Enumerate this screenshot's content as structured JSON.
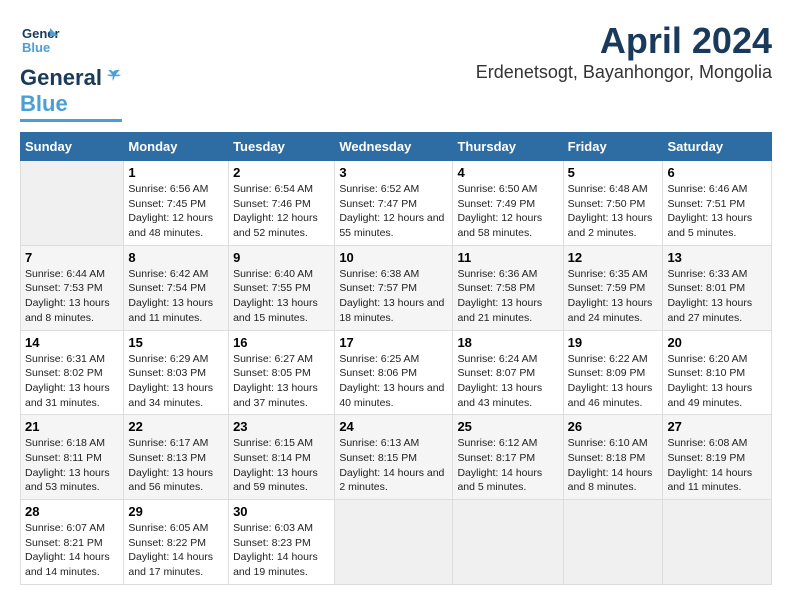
{
  "logo": {
    "line1": "General",
    "line2": "Blue"
  },
  "title": "April 2024",
  "subtitle": "Erdenetsogt, Bayanhongor, Mongolia",
  "days_of_week": [
    "Sunday",
    "Monday",
    "Tuesday",
    "Wednesday",
    "Thursday",
    "Friday",
    "Saturday"
  ],
  "weeks": [
    [
      {
        "day": "",
        "sunrise": "",
        "sunset": "",
        "daylight": ""
      },
      {
        "day": "1",
        "sunrise": "Sunrise: 6:56 AM",
        "sunset": "Sunset: 7:45 PM",
        "daylight": "Daylight: 12 hours and 48 minutes."
      },
      {
        "day": "2",
        "sunrise": "Sunrise: 6:54 AM",
        "sunset": "Sunset: 7:46 PM",
        "daylight": "Daylight: 12 hours and 52 minutes."
      },
      {
        "day": "3",
        "sunrise": "Sunrise: 6:52 AM",
        "sunset": "Sunset: 7:47 PM",
        "daylight": "Daylight: 12 hours and 55 minutes."
      },
      {
        "day": "4",
        "sunrise": "Sunrise: 6:50 AM",
        "sunset": "Sunset: 7:49 PM",
        "daylight": "Daylight: 12 hours and 58 minutes."
      },
      {
        "day": "5",
        "sunrise": "Sunrise: 6:48 AM",
        "sunset": "Sunset: 7:50 PM",
        "daylight": "Daylight: 13 hours and 2 minutes."
      },
      {
        "day": "6",
        "sunrise": "Sunrise: 6:46 AM",
        "sunset": "Sunset: 7:51 PM",
        "daylight": "Daylight: 13 hours and 5 minutes."
      }
    ],
    [
      {
        "day": "7",
        "sunrise": "Sunrise: 6:44 AM",
        "sunset": "Sunset: 7:53 PM",
        "daylight": "Daylight: 13 hours and 8 minutes."
      },
      {
        "day": "8",
        "sunrise": "Sunrise: 6:42 AM",
        "sunset": "Sunset: 7:54 PM",
        "daylight": "Daylight: 13 hours and 11 minutes."
      },
      {
        "day": "9",
        "sunrise": "Sunrise: 6:40 AM",
        "sunset": "Sunset: 7:55 PM",
        "daylight": "Daylight: 13 hours and 15 minutes."
      },
      {
        "day": "10",
        "sunrise": "Sunrise: 6:38 AM",
        "sunset": "Sunset: 7:57 PM",
        "daylight": "Daylight: 13 hours and 18 minutes."
      },
      {
        "day": "11",
        "sunrise": "Sunrise: 6:36 AM",
        "sunset": "Sunset: 7:58 PM",
        "daylight": "Daylight: 13 hours and 21 minutes."
      },
      {
        "day": "12",
        "sunrise": "Sunrise: 6:35 AM",
        "sunset": "Sunset: 7:59 PM",
        "daylight": "Daylight: 13 hours and 24 minutes."
      },
      {
        "day": "13",
        "sunrise": "Sunrise: 6:33 AM",
        "sunset": "Sunset: 8:01 PM",
        "daylight": "Daylight: 13 hours and 27 minutes."
      }
    ],
    [
      {
        "day": "14",
        "sunrise": "Sunrise: 6:31 AM",
        "sunset": "Sunset: 8:02 PM",
        "daylight": "Daylight: 13 hours and 31 minutes."
      },
      {
        "day": "15",
        "sunrise": "Sunrise: 6:29 AM",
        "sunset": "Sunset: 8:03 PM",
        "daylight": "Daylight: 13 hours and 34 minutes."
      },
      {
        "day": "16",
        "sunrise": "Sunrise: 6:27 AM",
        "sunset": "Sunset: 8:05 PM",
        "daylight": "Daylight: 13 hours and 37 minutes."
      },
      {
        "day": "17",
        "sunrise": "Sunrise: 6:25 AM",
        "sunset": "Sunset: 8:06 PM",
        "daylight": "Daylight: 13 hours and 40 minutes."
      },
      {
        "day": "18",
        "sunrise": "Sunrise: 6:24 AM",
        "sunset": "Sunset: 8:07 PM",
        "daylight": "Daylight: 13 hours and 43 minutes."
      },
      {
        "day": "19",
        "sunrise": "Sunrise: 6:22 AM",
        "sunset": "Sunset: 8:09 PM",
        "daylight": "Daylight: 13 hours and 46 minutes."
      },
      {
        "day": "20",
        "sunrise": "Sunrise: 6:20 AM",
        "sunset": "Sunset: 8:10 PM",
        "daylight": "Daylight: 13 hours and 49 minutes."
      }
    ],
    [
      {
        "day": "21",
        "sunrise": "Sunrise: 6:18 AM",
        "sunset": "Sunset: 8:11 PM",
        "daylight": "Daylight: 13 hours and 53 minutes."
      },
      {
        "day": "22",
        "sunrise": "Sunrise: 6:17 AM",
        "sunset": "Sunset: 8:13 PM",
        "daylight": "Daylight: 13 hours and 56 minutes."
      },
      {
        "day": "23",
        "sunrise": "Sunrise: 6:15 AM",
        "sunset": "Sunset: 8:14 PM",
        "daylight": "Daylight: 13 hours and 59 minutes."
      },
      {
        "day": "24",
        "sunrise": "Sunrise: 6:13 AM",
        "sunset": "Sunset: 8:15 PM",
        "daylight": "Daylight: 14 hours and 2 minutes."
      },
      {
        "day": "25",
        "sunrise": "Sunrise: 6:12 AM",
        "sunset": "Sunset: 8:17 PM",
        "daylight": "Daylight: 14 hours and 5 minutes."
      },
      {
        "day": "26",
        "sunrise": "Sunrise: 6:10 AM",
        "sunset": "Sunset: 8:18 PM",
        "daylight": "Daylight: 14 hours and 8 minutes."
      },
      {
        "day": "27",
        "sunrise": "Sunrise: 6:08 AM",
        "sunset": "Sunset: 8:19 PM",
        "daylight": "Daylight: 14 hours and 11 minutes."
      }
    ],
    [
      {
        "day": "28",
        "sunrise": "Sunrise: 6:07 AM",
        "sunset": "Sunset: 8:21 PM",
        "daylight": "Daylight: 14 hours and 14 minutes."
      },
      {
        "day": "29",
        "sunrise": "Sunrise: 6:05 AM",
        "sunset": "Sunset: 8:22 PM",
        "daylight": "Daylight: 14 hours and 17 minutes."
      },
      {
        "day": "30",
        "sunrise": "Sunrise: 6:03 AM",
        "sunset": "Sunset: 8:23 PM",
        "daylight": "Daylight: 14 hours and 19 minutes."
      },
      {
        "day": "",
        "sunrise": "",
        "sunset": "",
        "daylight": ""
      },
      {
        "day": "",
        "sunrise": "",
        "sunset": "",
        "daylight": ""
      },
      {
        "day": "",
        "sunrise": "",
        "sunset": "",
        "daylight": ""
      },
      {
        "day": "",
        "sunrise": "",
        "sunset": "",
        "daylight": ""
      }
    ]
  ]
}
